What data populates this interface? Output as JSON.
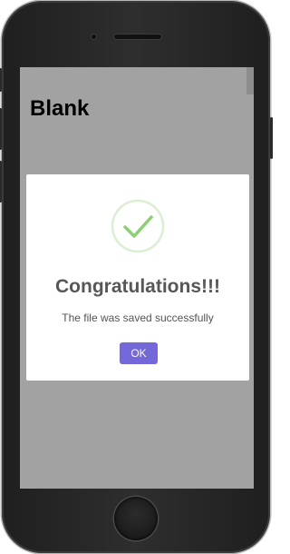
{
  "page": {
    "title": "Blank"
  },
  "dialog": {
    "icon": "checkmark-success-icon",
    "title": "Congratulations!!!",
    "message": "The file was saved successfully",
    "ok_label": "OK"
  },
  "colors": {
    "accent": "#7468d9",
    "success": "#8ccf75",
    "success_ring": "#dbeed2",
    "overlay": "#a2a2a2",
    "phone_body": "#262626"
  }
}
